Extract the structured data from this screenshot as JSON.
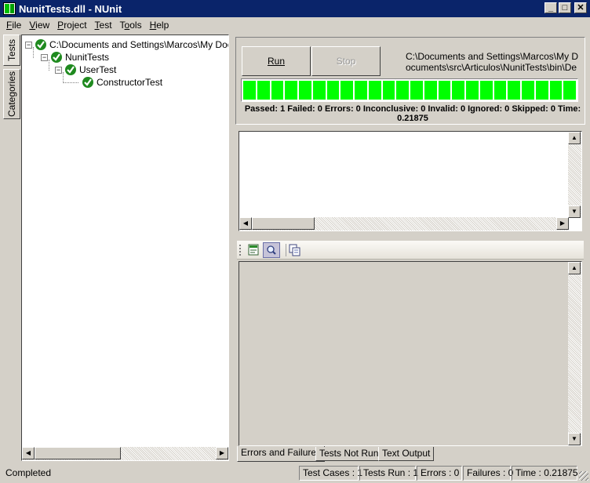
{
  "window": {
    "title": "NunitTests.dll - NUnit",
    "minimize_glyph": "_",
    "maximize_glyph": "□",
    "close_glyph": "✕"
  },
  "menu": {
    "items": [
      {
        "label": "File",
        "accel": "F",
        "rest": "ile"
      },
      {
        "label": "View",
        "accel": "V",
        "rest": "iew"
      },
      {
        "label": "Project",
        "accel": "P",
        "rest": "roject"
      },
      {
        "label": "Test",
        "accel": "T",
        "rest": "est"
      },
      {
        "label": "Tools",
        "accel": "o",
        "pre": "T",
        "rest": "ols"
      },
      {
        "label": "Help",
        "accel": "H",
        "rest": "elp"
      }
    ]
  },
  "side_tabs": {
    "tests": "Tests",
    "categories": "Categories"
  },
  "tree": {
    "nodes": [
      {
        "label": "C:\\Documents and Settings\\Marcos\\My Documents\\src\\Articulos\\NunitTests\\bin\\Debug\\NunitTests.dll",
        "expander": "−",
        "status": "passed"
      },
      {
        "label": "NunitTests",
        "expander": "−",
        "status": "passed"
      },
      {
        "label": "UserTest",
        "expander": "−",
        "status": "passed"
      },
      {
        "label": "ConstructorTest",
        "expander": "",
        "status": "passed"
      }
    ]
  },
  "run_panel": {
    "run_label": "Run",
    "stop_label": "Stop",
    "assembly_path": "C:\\Documents and Settings\\Marcos\\My Documents\\src\\Articulos\\NunitTests\\bin\\Debug\\NunitTests.dll",
    "progress_color": "#00ff00",
    "progress_fraction": 1.0,
    "status_line": "Passed: 1  Failed: 0  Errors: 0  Inconclusive: 0  Invalid: 0  Ignored: 0  Skipped: 0  Time: 0.21875"
  },
  "result_tabs": [
    {
      "label": "Errors and Failures",
      "active": true
    },
    {
      "label": "Tests Not Run",
      "active": false
    },
    {
      "label": "Text Output",
      "active": false
    }
  ],
  "statusbar": {
    "status": "Completed",
    "test_cases": "Test Cases : 1",
    "tests_run": "Tests Run : 1",
    "errors": "Errors : 0",
    "failures": "Failures : 0",
    "time": "Time : 0.21875"
  }
}
